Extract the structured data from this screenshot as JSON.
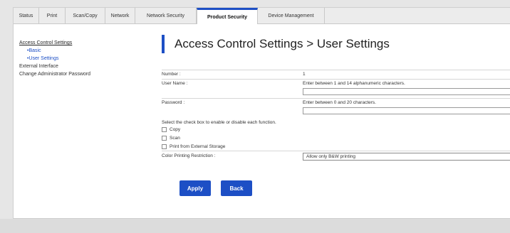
{
  "tabs": [
    {
      "label": "Status"
    },
    {
      "label": "Print"
    },
    {
      "label": "Scan/Copy"
    },
    {
      "label": "Network"
    },
    {
      "label": "Network Security"
    },
    {
      "label": "Product Security"
    },
    {
      "label": "Device Management"
    }
  ],
  "sidebar": {
    "section_title": "Access Control Settings",
    "sub_items": [
      {
        "label": "•Basic"
      },
      {
        "label": "•User Settings"
      }
    ],
    "items": [
      {
        "label": "External Interface"
      },
      {
        "label": "Change Administrator Password"
      }
    ]
  },
  "main": {
    "title": "Access Control Settings > User Settings",
    "number_label": "Number :",
    "number_value": "1",
    "username_label": "User Name :",
    "username_hint": "Enter between 1 and 14 alphanumeric characters.",
    "username_value": "",
    "password_label": "Password :",
    "password_hint": "Enter between 0 and 20 characters.",
    "password_value": "",
    "instruction": "Select the check box to enable or disable each function.",
    "checkboxes": [
      {
        "label": "Copy",
        "checked": false
      },
      {
        "label": "Scan",
        "checked": false
      },
      {
        "label": "Print from External Storage",
        "checked": false
      }
    ],
    "color_label": "Color Printing Restriction :",
    "color_value": "Allow only B&W printing"
  },
  "buttons": {
    "apply": "Apply",
    "back": "Back"
  },
  "colors": {
    "accent": "#1d4fc5"
  }
}
